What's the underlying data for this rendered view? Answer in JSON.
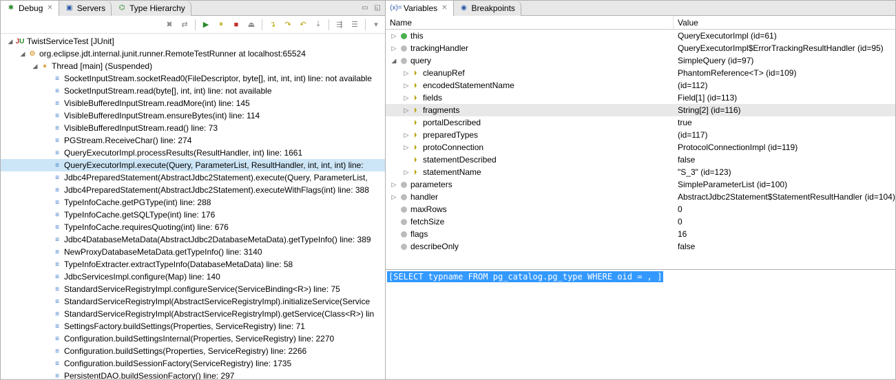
{
  "left": {
    "tabs": [
      {
        "label": "Debug",
        "active": true,
        "icon": "bug"
      },
      {
        "label": "Servers",
        "active": false,
        "icon": "server"
      },
      {
        "label": "Type Hierarchy",
        "active": false,
        "icon": "hierarchy"
      }
    ],
    "tree": [
      {
        "depth": 0,
        "arrow": "open",
        "icon": "junit",
        "selected": false,
        "label": "TwistServiceTest [JUnit]"
      },
      {
        "depth": 1,
        "arrow": "open",
        "icon": "process",
        "selected": false,
        "label": "org.eclipse.jdt.internal.junit.runner.RemoteTestRunner at localhost:65524"
      },
      {
        "depth": 2,
        "arrow": "open",
        "icon": "thread",
        "selected": false,
        "label": "Thread [main] (Suspended)"
      },
      {
        "depth": 3,
        "arrow": "none",
        "icon": "frame",
        "selected": false,
        "label": "SocketInputStream.socketRead0(FileDescriptor, byte[], int, int, int) line: not available"
      },
      {
        "depth": 3,
        "arrow": "none",
        "icon": "frame",
        "selected": false,
        "label": "SocketInputStream.read(byte[], int, int) line: not available"
      },
      {
        "depth": 3,
        "arrow": "none",
        "icon": "frame",
        "selected": false,
        "label": "VisibleBufferedInputStream.readMore(int) line: 145"
      },
      {
        "depth": 3,
        "arrow": "none",
        "icon": "frame",
        "selected": false,
        "label": "VisibleBufferedInputStream.ensureBytes(int) line: 114"
      },
      {
        "depth": 3,
        "arrow": "none",
        "icon": "frame",
        "selected": false,
        "label": "VisibleBufferedInputStream.read() line: 73"
      },
      {
        "depth": 3,
        "arrow": "none",
        "icon": "frame",
        "selected": false,
        "label": "PGStream.ReceiveChar() line: 274"
      },
      {
        "depth": 3,
        "arrow": "none",
        "icon": "frame",
        "selected": false,
        "label": "QueryExecutorImpl.processResults(ResultHandler, int) line: 1661"
      },
      {
        "depth": 3,
        "arrow": "none",
        "icon": "frame",
        "selected": true,
        "label": "QueryExecutorImpl.execute(Query, ParameterList, ResultHandler, int, int, int) line:"
      },
      {
        "depth": 3,
        "arrow": "none",
        "icon": "frame",
        "selected": false,
        "label": "Jdbc4PreparedStatement(AbstractJdbc2Statement).execute(Query, ParameterList,"
      },
      {
        "depth": 3,
        "arrow": "none",
        "icon": "frame",
        "selected": false,
        "label": "Jdbc4PreparedStatement(AbstractJdbc2Statement).executeWithFlags(int) line: 388"
      },
      {
        "depth": 3,
        "arrow": "none",
        "icon": "frame",
        "selected": false,
        "label": "TypeInfoCache.getPGType(int) line: 288"
      },
      {
        "depth": 3,
        "arrow": "none",
        "icon": "frame",
        "selected": false,
        "label": "TypeInfoCache.getSQLType(int) line: 176"
      },
      {
        "depth": 3,
        "arrow": "none",
        "icon": "frame",
        "selected": false,
        "label": "TypeInfoCache.requiresQuoting(int) line: 676"
      },
      {
        "depth": 3,
        "arrow": "none",
        "icon": "frame",
        "selected": false,
        "label": "Jdbc4DatabaseMetaData(AbstractJdbc2DatabaseMetaData).getTypeInfo() line: 389"
      },
      {
        "depth": 3,
        "arrow": "none",
        "icon": "frame",
        "selected": false,
        "label": "NewProxyDatabaseMetaData.getTypeInfo() line: 3140"
      },
      {
        "depth": 3,
        "arrow": "none",
        "icon": "frame",
        "selected": false,
        "label": "TypeInfoExtracter.extractTypeInfo(DatabaseMetaData) line: 58"
      },
      {
        "depth": 3,
        "arrow": "none",
        "icon": "frame",
        "selected": false,
        "label": "JdbcServicesImpl.configure(Map) line: 140"
      },
      {
        "depth": 3,
        "arrow": "none",
        "icon": "frame",
        "selected": false,
        "label": "StandardServiceRegistryImpl.configureService(ServiceBinding<R>) line: 75"
      },
      {
        "depth": 3,
        "arrow": "none",
        "icon": "frame",
        "selected": false,
        "label": "StandardServiceRegistryImpl(AbstractServiceRegistryImpl).initializeService(Service"
      },
      {
        "depth": 3,
        "arrow": "none",
        "icon": "frame",
        "selected": false,
        "label": "StandardServiceRegistryImpl(AbstractServiceRegistryImpl).getService(Class<R>) lin"
      },
      {
        "depth": 3,
        "arrow": "none",
        "icon": "frame",
        "selected": false,
        "label": "SettingsFactory.buildSettings(Properties, ServiceRegistry) line: 71"
      },
      {
        "depth": 3,
        "arrow": "none",
        "icon": "frame",
        "selected": false,
        "label": "Configuration.buildSettingsInternal(Properties, ServiceRegistry) line: 2270"
      },
      {
        "depth": 3,
        "arrow": "none",
        "icon": "frame",
        "selected": false,
        "label": "Configuration.buildSettings(Properties, ServiceRegistry) line: 2266"
      },
      {
        "depth": 3,
        "arrow": "none",
        "icon": "frame",
        "selected": false,
        "label": "Configuration.buildSessionFactory(ServiceRegistry) line: 1735"
      },
      {
        "depth": 3,
        "arrow": "none",
        "icon": "frame",
        "selected": false,
        "label": "PersistentDAO.buildSessionFactory() line: 297"
      }
    ]
  },
  "right": {
    "tabs": [
      {
        "label": "Variables",
        "active": true,
        "icon": "vars"
      },
      {
        "label": "Breakpoints",
        "active": false,
        "icon": "bp"
      }
    ],
    "headers": {
      "name": "Name",
      "value": "Value"
    },
    "rows": [
      {
        "depth": 0,
        "arrow": "closed",
        "icon": "this",
        "selected": false,
        "name": "this",
        "value": "QueryExecutorImpl  (id=61)"
      },
      {
        "depth": 0,
        "arrow": "closed",
        "icon": "local",
        "selected": false,
        "name": "trackingHandler",
        "value": "QueryExecutorImpl$ErrorTrackingResultHandler  (id=95)"
      },
      {
        "depth": 0,
        "arrow": "open",
        "icon": "local",
        "selected": false,
        "name": "query",
        "value": "SimpleQuery  (id=97)"
      },
      {
        "depth": 1,
        "arrow": "closed",
        "icon": "field",
        "selected": false,
        "name": "cleanupRef",
        "value": "PhantomReference<T>  (id=109)"
      },
      {
        "depth": 1,
        "arrow": "closed",
        "icon": "field",
        "selected": false,
        "name": "encodedStatementName",
        "value": "(id=112)"
      },
      {
        "depth": 1,
        "arrow": "closed",
        "icon": "field",
        "selected": false,
        "name": "fields",
        "value": "Field[1]  (id=113)"
      },
      {
        "depth": 1,
        "arrow": "closed",
        "icon": "field",
        "selected": true,
        "name": "fragments",
        "value": "String[2]  (id=116)"
      },
      {
        "depth": 1,
        "arrow": "none",
        "icon": "field",
        "selected": false,
        "name": "portalDescribed",
        "value": "true"
      },
      {
        "depth": 1,
        "arrow": "closed",
        "icon": "field",
        "selected": false,
        "name": "preparedTypes",
        "value": "(id=117)"
      },
      {
        "depth": 1,
        "arrow": "closed",
        "icon": "field",
        "selected": false,
        "name": "protoConnection",
        "value": "ProtocolConnectionImpl  (id=119)"
      },
      {
        "depth": 1,
        "arrow": "none",
        "icon": "field",
        "selected": false,
        "name": "statementDescribed",
        "value": "false"
      },
      {
        "depth": 1,
        "arrow": "closed",
        "icon": "field",
        "selected": false,
        "name": "statementName",
        "value": "\"S_3\"  (id=123)"
      },
      {
        "depth": 0,
        "arrow": "closed",
        "icon": "local",
        "selected": false,
        "name": "parameters",
        "value": "SimpleParameterList  (id=100)"
      },
      {
        "depth": 0,
        "arrow": "closed",
        "icon": "local",
        "selected": false,
        "name": "handler",
        "value": "AbstractJdbc2Statement$StatementResultHandler  (id=104)"
      },
      {
        "depth": 0,
        "arrow": "none",
        "icon": "local",
        "selected": false,
        "name": "maxRows",
        "value": "0"
      },
      {
        "depth": 0,
        "arrow": "none",
        "icon": "local",
        "selected": false,
        "name": "fetchSize",
        "value": "0"
      },
      {
        "depth": 0,
        "arrow": "none",
        "icon": "local",
        "selected": false,
        "name": "flags",
        "value": "16"
      },
      {
        "depth": 0,
        "arrow": "none",
        "icon": "local",
        "selected": false,
        "name": "describeOnly",
        "value": "false"
      }
    ],
    "detail": "[SELECT typname FROM pg_catalog.pg_type WHERE oid = , ]"
  }
}
